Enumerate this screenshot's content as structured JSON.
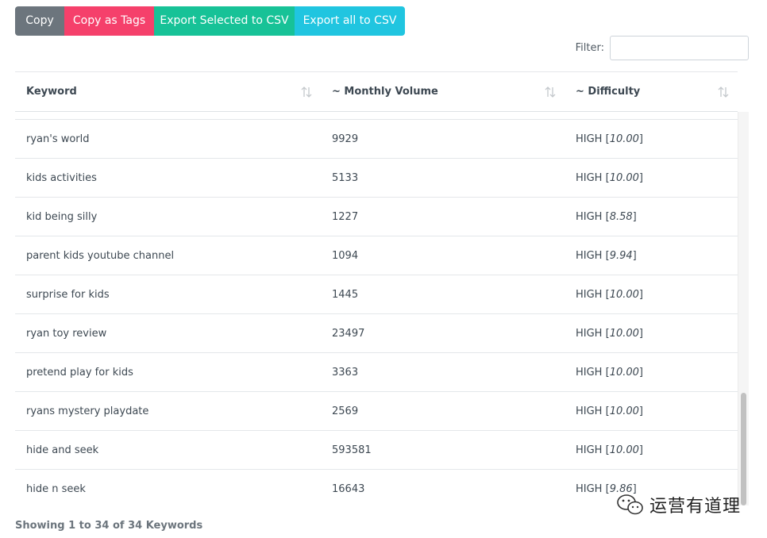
{
  "toolbar": {
    "copy_label": "Copy",
    "copy_tags_label": "Copy as Tags",
    "export_selected_label": "Export Selected to CSV",
    "export_all_label": "Export all to CSV"
  },
  "filter": {
    "label": "Filter:",
    "value": "",
    "placeholder": ""
  },
  "table": {
    "headers": [
      {
        "label": "Keyword"
      },
      {
        "label": "~ Monthly Volume"
      },
      {
        "label": "~ Difficulty"
      }
    ],
    "rows": [
      {
        "keyword": "ryan's world",
        "volume": "9929",
        "level": "HIGH",
        "score": "10.00"
      },
      {
        "keyword": "kids activities",
        "volume": "5133",
        "level": "HIGH",
        "score": "10.00"
      },
      {
        "keyword": "kid being silly",
        "volume": "1227",
        "level": "HIGH",
        "score": "8.58"
      },
      {
        "keyword": "parent kids youtube channel",
        "volume": "1094",
        "level": "HIGH",
        "score": "9.94"
      },
      {
        "keyword": "surprise for kids",
        "volume": "1445",
        "level": "HIGH",
        "score": "10.00"
      },
      {
        "keyword": "ryan toy review",
        "volume": "23497",
        "level": "HIGH",
        "score": "10.00"
      },
      {
        "keyword": "pretend play for kids",
        "volume": "3363",
        "level": "HIGH",
        "score": "10.00"
      },
      {
        "keyword": "ryans mystery playdate",
        "volume": "2569",
        "level": "HIGH",
        "score": "10.00"
      },
      {
        "keyword": "hide and seek",
        "volume": "593581",
        "level": "HIGH",
        "score": "10.00"
      },
      {
        "keyword": "hide n seek",
        "volume": "16643",
        "level": "HIGH",
        "score": "9.86"
      }
    ]
  },
  "info": "Showing 1 to 34 of 34 Keywords",
  "watermark": {
    "text": "运营有道理",
    "icon": "wechat-icon"
  },
  "colors": {
    "copy": "#6c757d",
    "copy_tags": "#f5406b",
    "export_selected": "#17c297",
    "export_all": "#20c5e0"
  }
}
